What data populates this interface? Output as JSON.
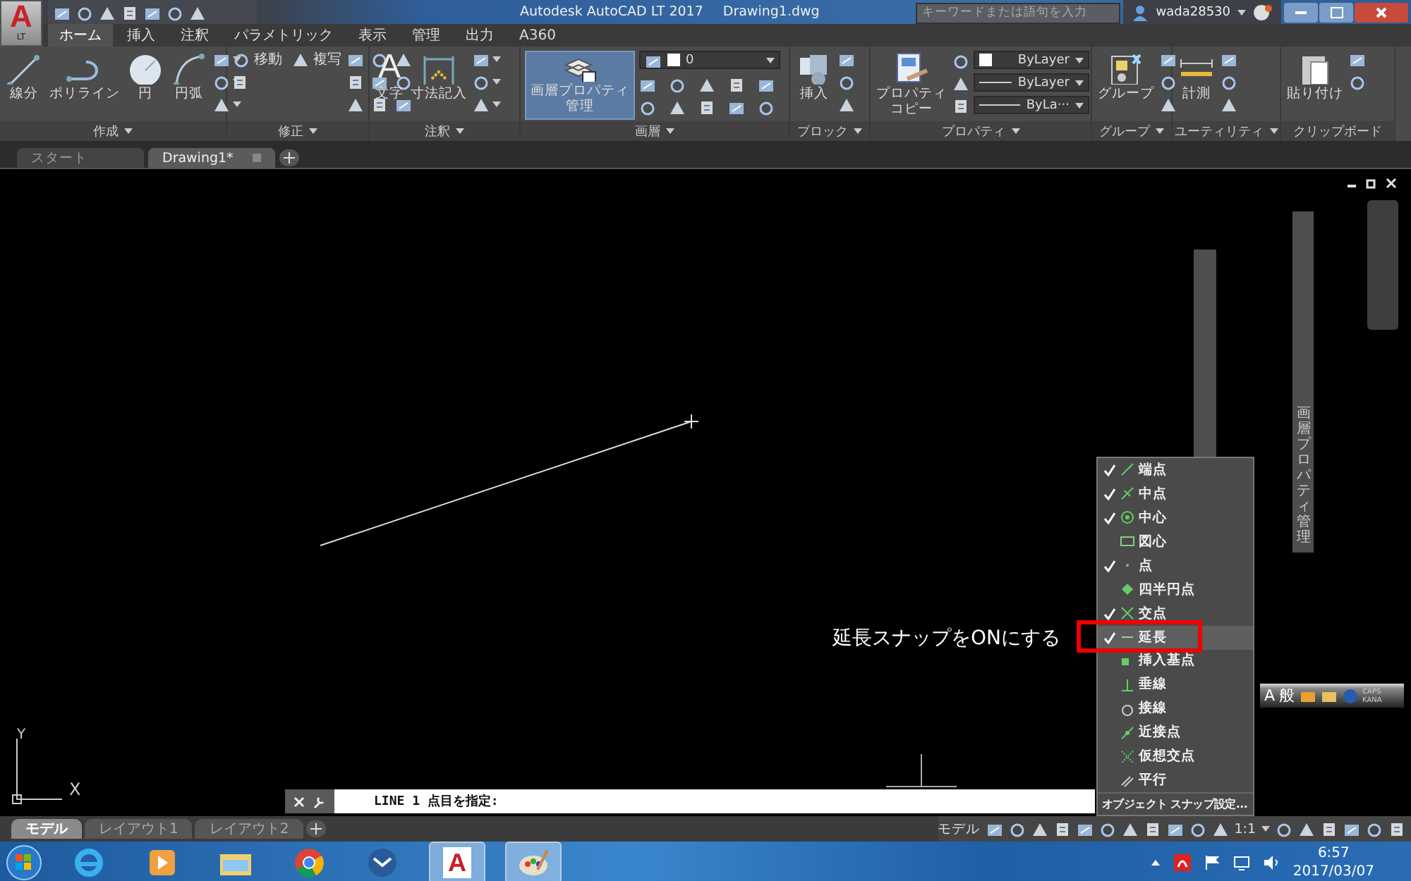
{
  "title_bar": {
    "app_button": {
      "letter": "A",
      "edition": "LT"
    },
    "title": "Autodesk AutoCAD LT 2017",
    "filename": "Drawing1.dwg",
    "search": {
      "placeholder": "キーワードまたは語句を入力"
    },
    "user": "wada28530"
  },
  "ribbon_tabs": [
    {
      "label": "ホーム",
      "selected": true
    },
    {
      "label": "挿入",
      "selected": false
    },
    {
      "label": "注釈",
      "selected": false
    },
    {
      "label": "パラメトリック",
      "selected": false
    },
    {
      "label": "表示",
      "selected": false
    },
    {
      "label": "管理",
      "selected": false
    },
    {
      "label": "出力",
      "selected": false
    },
    {
      "label": "A360",
      "selected": false
    }
  ],
  "ribbon_panels": [
    {
      "kind": "draw",
      "title": "作成",
      "has_menu": true,
      "tools": [
        {
          "label": "線分"
        },
        {
          "label": "ポリライン"
        },
        {
          "label": "円"
        },
        {
          "label": "円弧"
        }
      ]
    },
    {
      "kind": "modify",
      "title": "修正",
      "has_menu": true,
      "tools": [
        {
          "label": "移動"
        },
        {
          "label": "複写"
        }
      ]
    },
    {
      "kind": "annotation",
      "title": "注釈",
      "has_menu": true,
      "tools": [
        {
          "label": "文字",
          "glyph": "A"
        },
        {
          "label": "寸法記入"
        }
      ]
    },
    {
      "kind": "layers",
      "title": "画層",
      "has_menu": true,
      "tools": [
        {
          "lines": [
            "画層プロパティ",
            "管理"
          ]
        }
      ],
      "layer": "0"
    },
    {
      "kind": "block",
      "title": "ブロック",
      "has_menu": true,
      "tools": [
        {
          "label": "挿入"
        }
      ]
    },
    {
      "kind": "properties",
      "title": "プロパティ",
      "has_menu": true,
      "tools": [
        {
          "lines": [
            "プロパティ",
            "コピー"
          ]
        }
      ],
      "dropdowns": [
        "ByLayer",
        "ByLayer",
        "ByLa···"
      ]
    },
    {
      "kind": "groups",
      "title": "グループ",
      "has_menu": true,
      "tools": [
        {
          "label": "グループ"
        }
      ]
    },
    {
      "kind": "utilities",
      "title": "ユーティリティ",
      "has_menu": true,
      "tools": [
        {
          "label": "計測"
        }
      ]
    },
    {
      "kind": "clipboard",
      "title": "クリップボード",
      "has_menu": false,
      "tools": [
        {
          "label": "貼り付け"
        }
      ]
    }
  ],
  "doc_tabs": [
    {
      "label": "スタート",
      "selected": false
    },
    {
      "label": "Drawing1*",
      "selected": true
    }
  ],
  "canvas": {
    "ucs": {
      "y_label": "Y",
      "x_label": "X"
    },
    "note": "延長スナップをONにする",
    "palette": {
      "title": "画層プロパティ管理"
    },
    "ime_bar": {
      "mode": "A",
      "input": "般",
      "caps": "CAPS",
      "kana": "KANA"
    },
    "command_line": {
      "prompt": "LINE 1 点目を指定:"
    },
    "snap_menu": {
      "items": [
        {
          "label": "端点",
          "checked": true,
          "selected": false
        },
        {
          "label": "中点",
          "checked": true,
          "selected": false
        },
        {
          "label": "中心",
          "checked": true,
          "selected": false
        },
        {
          "label": "図心",
          "checked": false,
          "selected": false
        },
        {
          "label": "点",
          "checked": true,
          "selected": false
        },
        {
          "label": "四半円点",
          "checked": false,
          "selected": false
        },
        {
          "label": "交点",
          "checked": true,
          "selected": false
        },
        {
          "label": "延長",
          "checked": true,
          "selected": true
        },
        {
          "label": "挿入基点",
          "checked": false,
          "selected": false
        },
        {
          "label": "垂線",
          "checked": false,
          "selected": false
        },
        {
          "label": "接線",
          "checked": false,
          "selected": false
        },
        {
          "label": "近接点",
          "checked": false,
          "selected": false
        },
        {
          "label": "仮想交点",
          "checked": false,
          "selected": false
        },
        {
          "label": "平行",
          "checked": false,
          "selected": false
        }
      ],
      "footer": "オブジェクト スナップ設定..."
    }
  },
  "layout_tabs": [
    {
      "label": "モデル",
      "selected": true
    },
    {
      "label": "レイアウト1",
      "selected": false
    },
    {
      "label": "レイアウト2",
      "selected": false
    }
  ],
  "status_bar": {
    "space": "モデル",
    "scale": "1:1"
  },
  "taskbar": {
    "apps": [
      {
        "kind": "ie",
        "active": false
      },
      {
        "kind": "media",
        "active": false
      },
      {
        "kind": "folder",
        "active": false
      },
      {
        "kind": "chrome",
        "active": false
      },
      {
        "kind": "mail",
        "active": false
      },
      {
        "kind": "autocad",
        "glyph": "A",
        "active": true
      },
      {
        "kind": "paint",
        "active": true
      }
    ],
    "time": "6:57",
    "date": "2017/03/07"
  }
}
